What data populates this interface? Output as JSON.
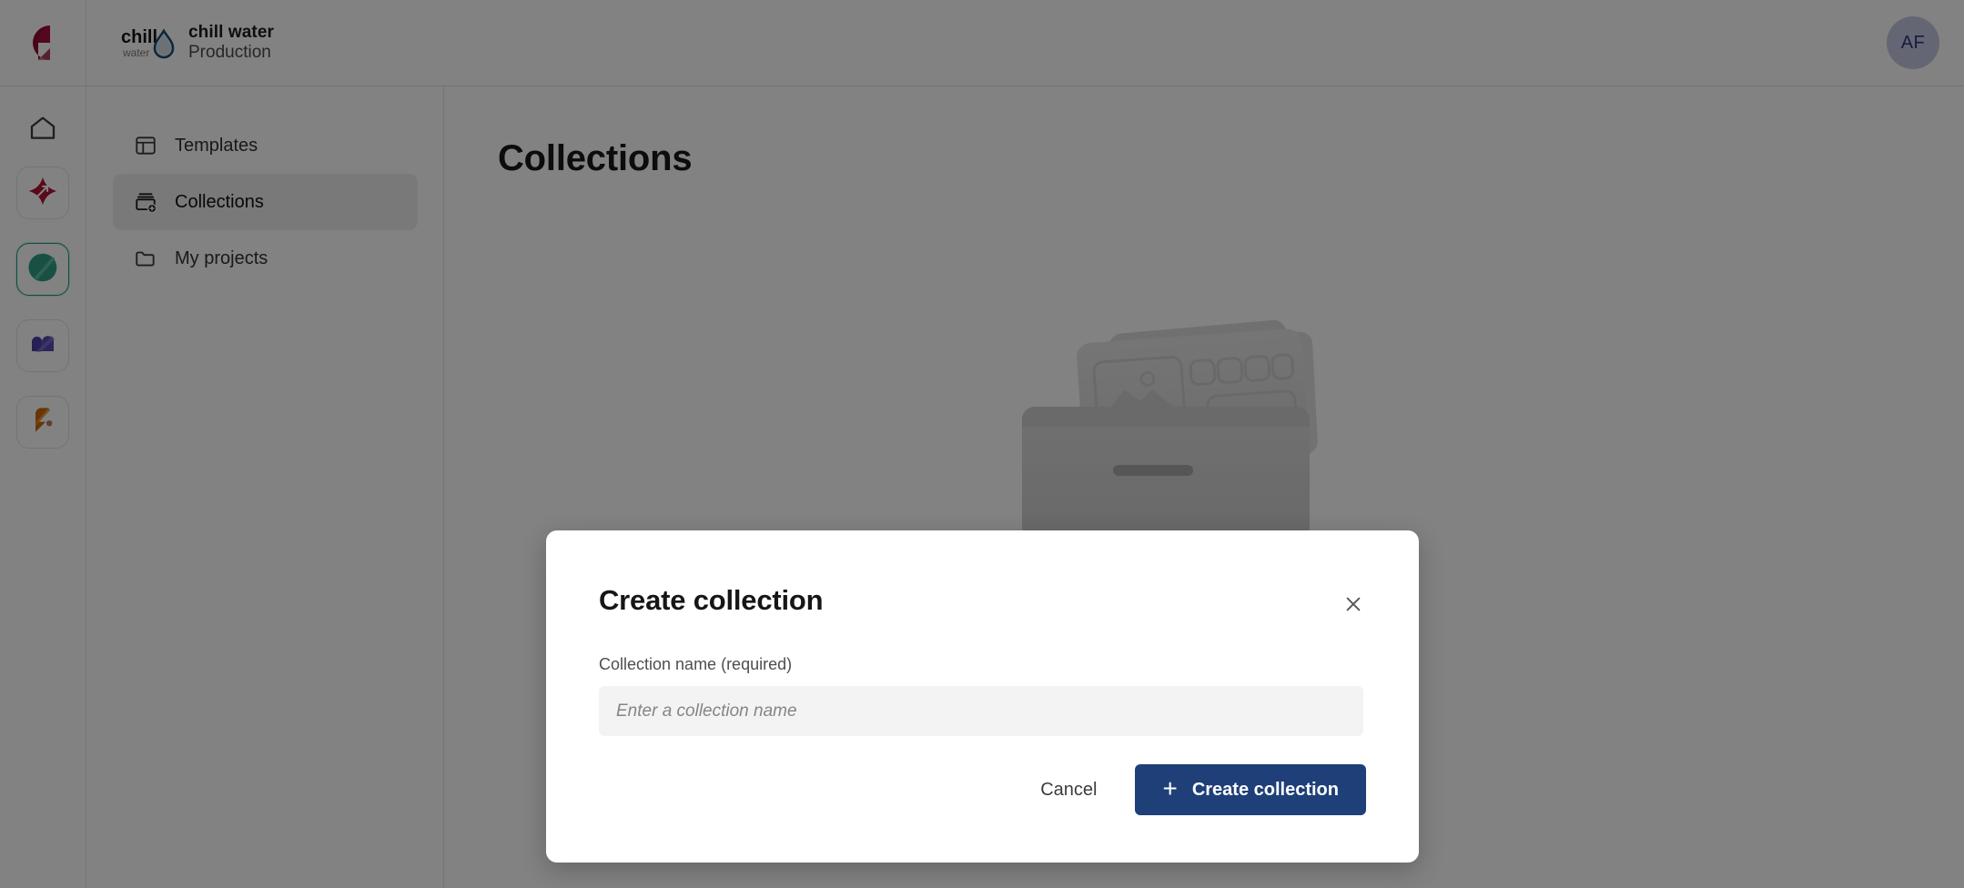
{
  "topbar": {
    "brand_icon": "company-logo-mark",
    "tenant_logo_icon": "chill-water-droplet-logo",
    "tenant_name": "chill water",
    "tenant_env": "Production",
    "avatar_initials": "AF"
  },
  "rail": {
    "home_icon": "home-icon",
    "apps": [
      {
        "icon": "star-burst-app-icon",
        "active": false
      },
      {
        "icon": "leaf-app-icon",
        "active": true
      },
      {
        "icon": "heart-app-icon",
        "active": false
      },
      {
        "icon": "flame-app-icon",
        "active": false
      }
    ]
  },
  "sidebar": {
    "items": [
      {
        "label": "Templates",
        "icon": "layout-template-icon",
        "active": false
      },
      {
        "label": "Collections",
        "icon": "collection-add-icon",
        "active": true
      },
      {
        "label": "My projects",
        "icon": "folder-icon",
        "active": false
      }
    ]
  },
  "main": {
    "page_title": "Collections",
    "empty_illustration_icon": "card-box-illustration"
  },
  "modal": {
    "title": "Create collection",
    "close_icon": "close-icon",
    "field_label": "Collection name (required)",
    "field_value": "",
    "field_placeholder": "Enter a collection name",
    "cancel_label": "Cancel",
    "submit_label": "Create collection",
    "submit_icon": "plus-icon",
    "accent_color": "#1e3f78"
  }
}
